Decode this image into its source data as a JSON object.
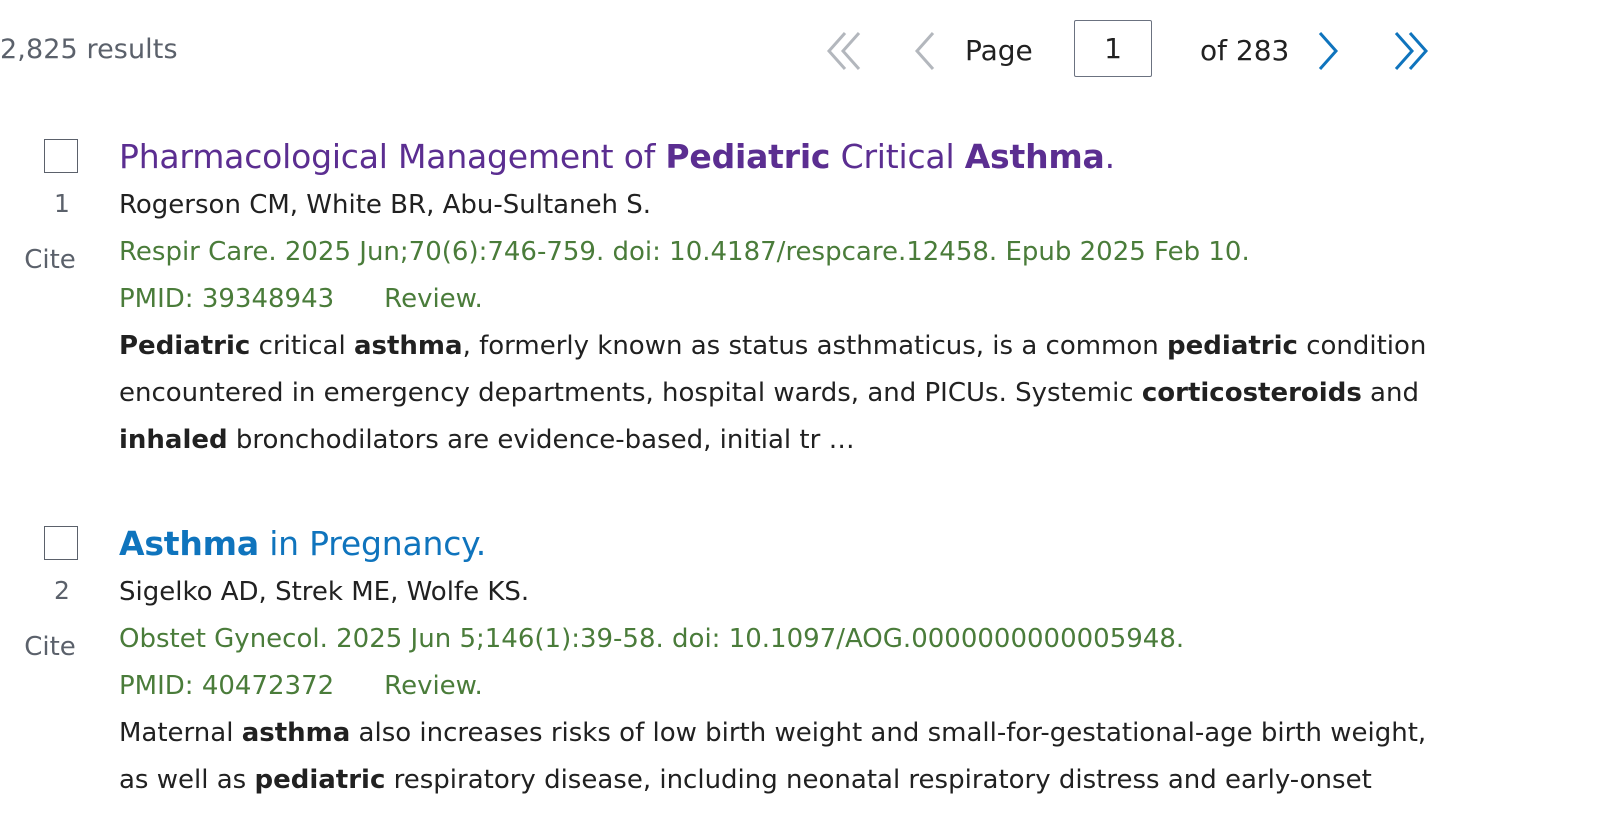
{
  "results_count": "2,825 results",
  "pagination": {
    "page_label": "Page",
    "current_page": "1",
    "total_pages": "of 283",
    "icons": {
      "first": "double-chevron-left-icon",
      "prev": "chevron-left-icon",
      "next": "chevron-right-icon",
      "last": "double-chevron-right-icon"
    },
    "colors": {
      "disabled": "#b3b7bd",
      "active": "#0f74bd"
    }
  },
  "results": [
    {
      "number": "1",
      "cite_label": "Cite",
      "title_parts": [
        {
          "text": "Pharmacological Management of ",
          "bold": false
        },
        {
          "text": "Pediatric",
          "bold": true
        },
        {
          "text": " Critical ",
          "bold": false
        },
        {
          "text": "Asthma",
          "bold": true
        },
        {
          "text": ".",
          "bold": false
        }
      ],
      "title_color": "#5b2e91",
      "authors": "Rogerson CM, White BR, Abu-Sultaneh S.",
      "citation": "Respir Care. 2025 Jun;70(6):746-759. doi: 10.4187/respcare.12458. Epub 2025 Feb 10.",
      "pmid": "PMID: 39348943",
      "publication_type": "Review.",
      "snippet_lines": [
        [
          {
            "text": "Pediatric",
            "bold": true
          },
          {
            "text": " critical ",
            "bold": false
          },
          {
            "text": "asthma",
            "bold": true
          },
          {
            "text": ", formerly known as status asthmaticus, is a common ",
            "bold": false
          },
          {
            "text": "pediatric",
            "bold": true
          },
          {
            "text": " condition",
            "bold": false
          }
        ],
        [
          {
            "text": "encountered in emergency departments, hospital wards, and PICUs. Systemic ",
            "bold": false
          },
          {
            "text": "corticosteroids",
            "bold": true
          },
          {
            "text": " and",
            "bold": false
          }
        ],
        [
          {
            "text": "inhaled",
            "bold": true
          },
          {
            "text": " bronchodilators are evidence-based, initial tr …",
            "bold": false
          }
        ]
      ]
    },
    {
      "number": "2",
      "cite_label": "Cite",
      "title_parts": [
        {
          "text": "Asthma",
          "bold": true
        },
        {
          "text": " in Pregnancy.",
          "bold": false
        }
      ],
      "title_color": "#0f74bd",
      "authors": "Sigelko AD, Strek ME, Wolfe KS.",
      "citation": "Obstet Gynecol. 2025 Jun 5;146(1):39-58. doi: 10.1097/AOG.0000000000005948.",
      "pmid": "PMID: 40472372",
      "publication_type": "Review.",
      "snippet_lines": [
        [
          {
            "text": "Maternal ",
            "bold": false
          },
          {
            "text": "asthma",
            "bold": true
          },
          {
            "text": " also increases risks of low birth weight and small-for-gestational-age birth weight,",
            "bold": false
          }
        ],
        [
          {
            "text": "as well as ",
            "bold": false
          },
          {
            "text": "pediatric",
            "bold": true
          },
          {
            "text": " respiratory disease, including neonatal respiratory distress and early-onset",
            "bold": false
          }
        ]
      ]
    }
  ],
  "colors": {
    "citation_green": "#4a7c3a",
    "muted_gray": "#5b616b"
  }
}
